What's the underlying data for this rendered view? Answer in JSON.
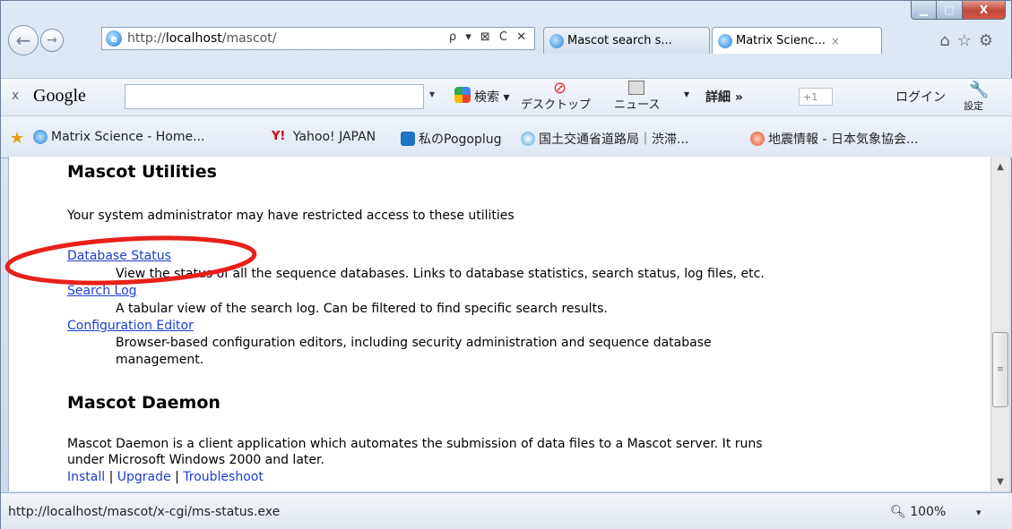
{
  "window": {
    "minimize_icon": "minimize-icon",
    "maximize_icon": "maximize-icon",
    "close_icon": "close-icon",
    "close_label": "X"
  },
  "address_bar": {
    "url_prefix": "http://",
    "url_host": "localhost",
    "url_path": "/mascot/",
    "tools": "ρ ▾ ⊠ C ✕"
  },
  "tabs": [
    {
      "label": "Mascot search s...",
      "close": ""
    },
    {
      "label": "Matrix Scienc...",
      "close": "×"
    }
  ],
  "google_toolbar": {
    "close": "x",
    "logo": "Google",
    "dropdown": "▾",
    "search_label": "検索 ▾",
    "desktop_label": "デスクトップ",
    "news_label": "ニュース",
    "news_dropdown": "▾",
    "more_label": "詳細 »",
    "plus_label": "+1",
    "login_label": "ログイン",
    "settings_label": "設定"
  },
  "favorites": [
    {
      "label": "Matrix Science - Home...",
      "icon": "ie-page-icon"
    },
    {
      "label": "Yahoo! JAPAN",
      "icon_text": "Y!",
      "icon": "yahoo-icon"
    },
    {
      "label": "私のPogoplug",
      "icon": "pogoplug-icon"
    },
    {
      "label": "国土交通省道路局｜渋滞...",
      "icon": "road-bureau-icon"
    },
    {
      "label": "地震情報 - 日本気象協会...",
      "icon": "weather-icon"
    }
  ],
  "content": {
    "section1_heading": "Mascot Utilities",
    "section1_intro": "Your system administrator may have restricted access to these utilities",
    "utilities": [
      {
        "link": "Database Status",
        "desc": "View the status of all the sequence databases. Links to database statistics, search status, log files, etc."
      },
      {
        "link": "Search Log",
        "desc": "A tabular view of the search log. Can be filtered to find specific search results."
      },
      {
        "link": "Configuration Editor",
        "desc": "Browser-based configuration editors, including security administration and sequence database",
        "desc2": "management."
      }
    ],
    "section2_heading": "Mascot Daemon",
    "section2_text1": "Mascot Daemon is a client application which automates the submission of data files to a Mascot server. It runs",
    "section2_text2": "under Microsoft Windows 2000 and later.",
    "links": {
      "install": "Install",
      "sep": "|",
      "upgrade": "Upgrade",
      "troubleshoot": "Troubleshoot"
    }
  },
  "status_bar": {
    "url": "http://localhost/mascot/x-cgi/ms-status.exe",
    "zoom": "100%",
    "zoom_dropdown": "▾"
  },
  "colors": {
    "link": "#1a3fcd",
    "annotation": "#e8201a",
    "close_button": "#c0473a"
  }
}
